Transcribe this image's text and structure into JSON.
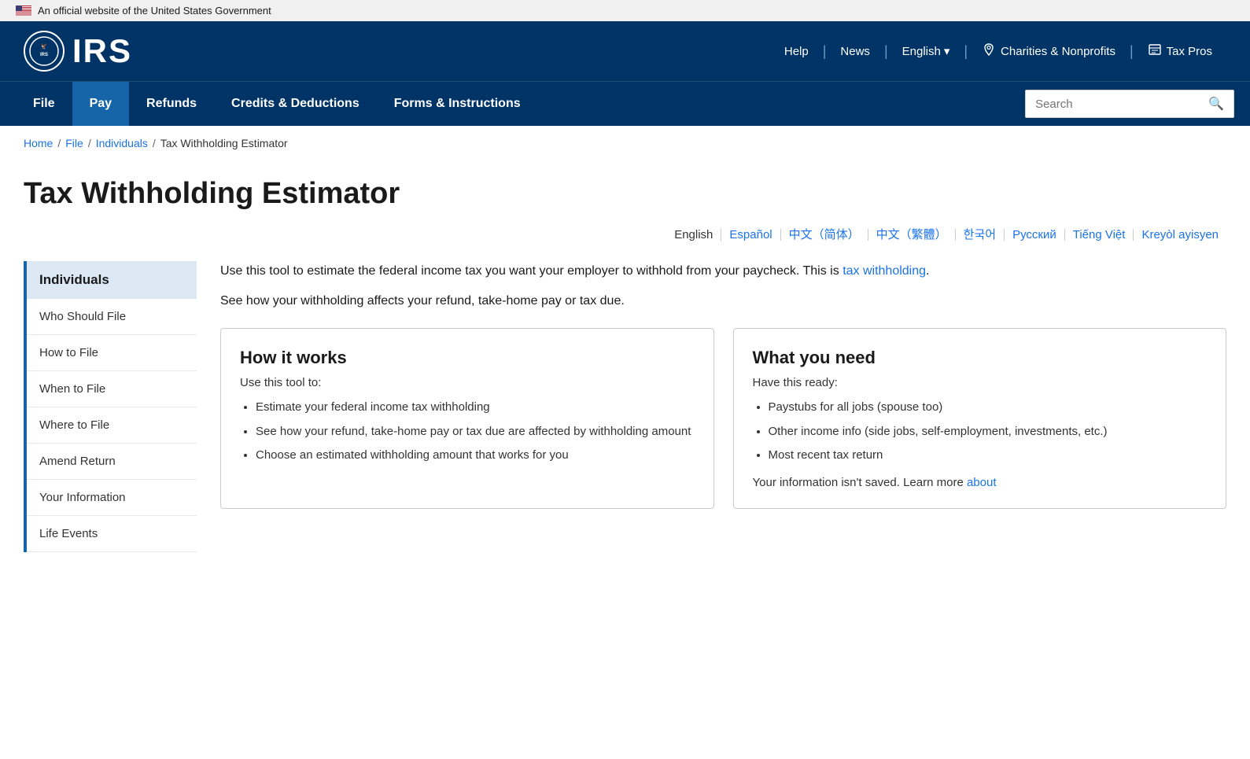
{
  "govBanner": {
    "text": "An official website of the United States Government"
  },
  "header": {
    "logoText": "IRS",
    "links": [
      {
        "label": "Help",
        "id": "help"
      },
      {
        "label": "News",
        "id": "news"
      },
      {
        "label": "English",
        "id": "english",
        "hasDropdown": true
      },
      {
        "label": "Charities & Nonprofits",
        "id": "charities",
        "hasIcon": "charities"
      },
      {
        "label": "Tax Pros",
        "id": "taxpros",
        "hasIcon": "taxpros"
      }
    ]
  },
  "nav": {
    "items": [
      {
        "label": "File",
        "id": "file",
        "active": false
      },
      {
        "label": "Pay",
        "id": "pay",
        "active": true
      },
      {
        "label": "Refunds",
        "id": "refunds",
        "active": false
      },
      {
        "label": "Credits & Deductions",
        "id": "credits",
        "active": false
      },
      {
        "label": "Forms & Instructions",
        "id": "forms",
        "active": false
      }
    ],
    "searchPlaceholder": "Search"
  },
  "breadcrumb": {
    "items": [
      {
        "label": "Home",
        "link": true
      },
      {
        "label": "File",
        "link": true
      },
      {
        "label": "Individuals",
        "link": true
      },
      {
        "label": "Tax Withholding Estimator",
        "link": false
      }
    ]
  },
  "pageTitle": "Tax Withholding Estimator",
  "languages": [
    {
      "label": "English",
      "current": true
    },
    {
      "label": "Español",
      "link": true
    },
    {
      "label": "中文（简体）",
      "link": true
    },
    {
      "label": "中文（繁體）",
      "link": true
    },
    {
      "label": "한국어",
      "link": true
    },
    {
      "label": "Русский",
      "link": true
    },
    {
      "label": "Tiếng Việt",
      "link": true
    },
    {
      "label": "Kreyòl ayisyen",
      "link": true
    }
  ],
  "sidebar": {
    "title": "Individuals",
    "items": [
      {
        "label": "Who Should File"
      },
      {
        "label": "How to File"
      },
      {
        "label": "When to File"
      },
      {
        "label": "Where to File"
      },
      {
        "label": "Amend Return"
      },
      {
        "label": "Your Information"
      },
      {
        "label": "Life Events"
      }
    ]
  },
  "intro": {
    "text1": "Use this tool to estimate the federal income tax you want your employer to withhold from your paycheck. This is ",
    "link": "tax withholding",
    "text2": ".",
    "text3": "See how your withholding affects your refund, take-home pay or tax due."
  },
  "cards": {
    "howItWorks": {
      "title": "How it works",
      "subtitle": "Use this tool to:",
      "bullets": [
        "Estimate your federal income tax withholding",
        "See how your refund, take-home pay or tax due are affected by withholding amount",
        "Choose an estimated withholding amount that works for you"
      ]
    },
    "whatYouNeed": {
      "title": "What you need",
      "subtitle": "Have this ready:",
      "bullets": [
        "Paystubs for all jobs (spouse too)",
        "Other income info (side jobs, self-employment, investments, etc.)",
        "Most recent tax return"
      ],
      "footer": "Your information isn't saved. Learn more ",
      "footerLink": "about"
    }
  }
}
